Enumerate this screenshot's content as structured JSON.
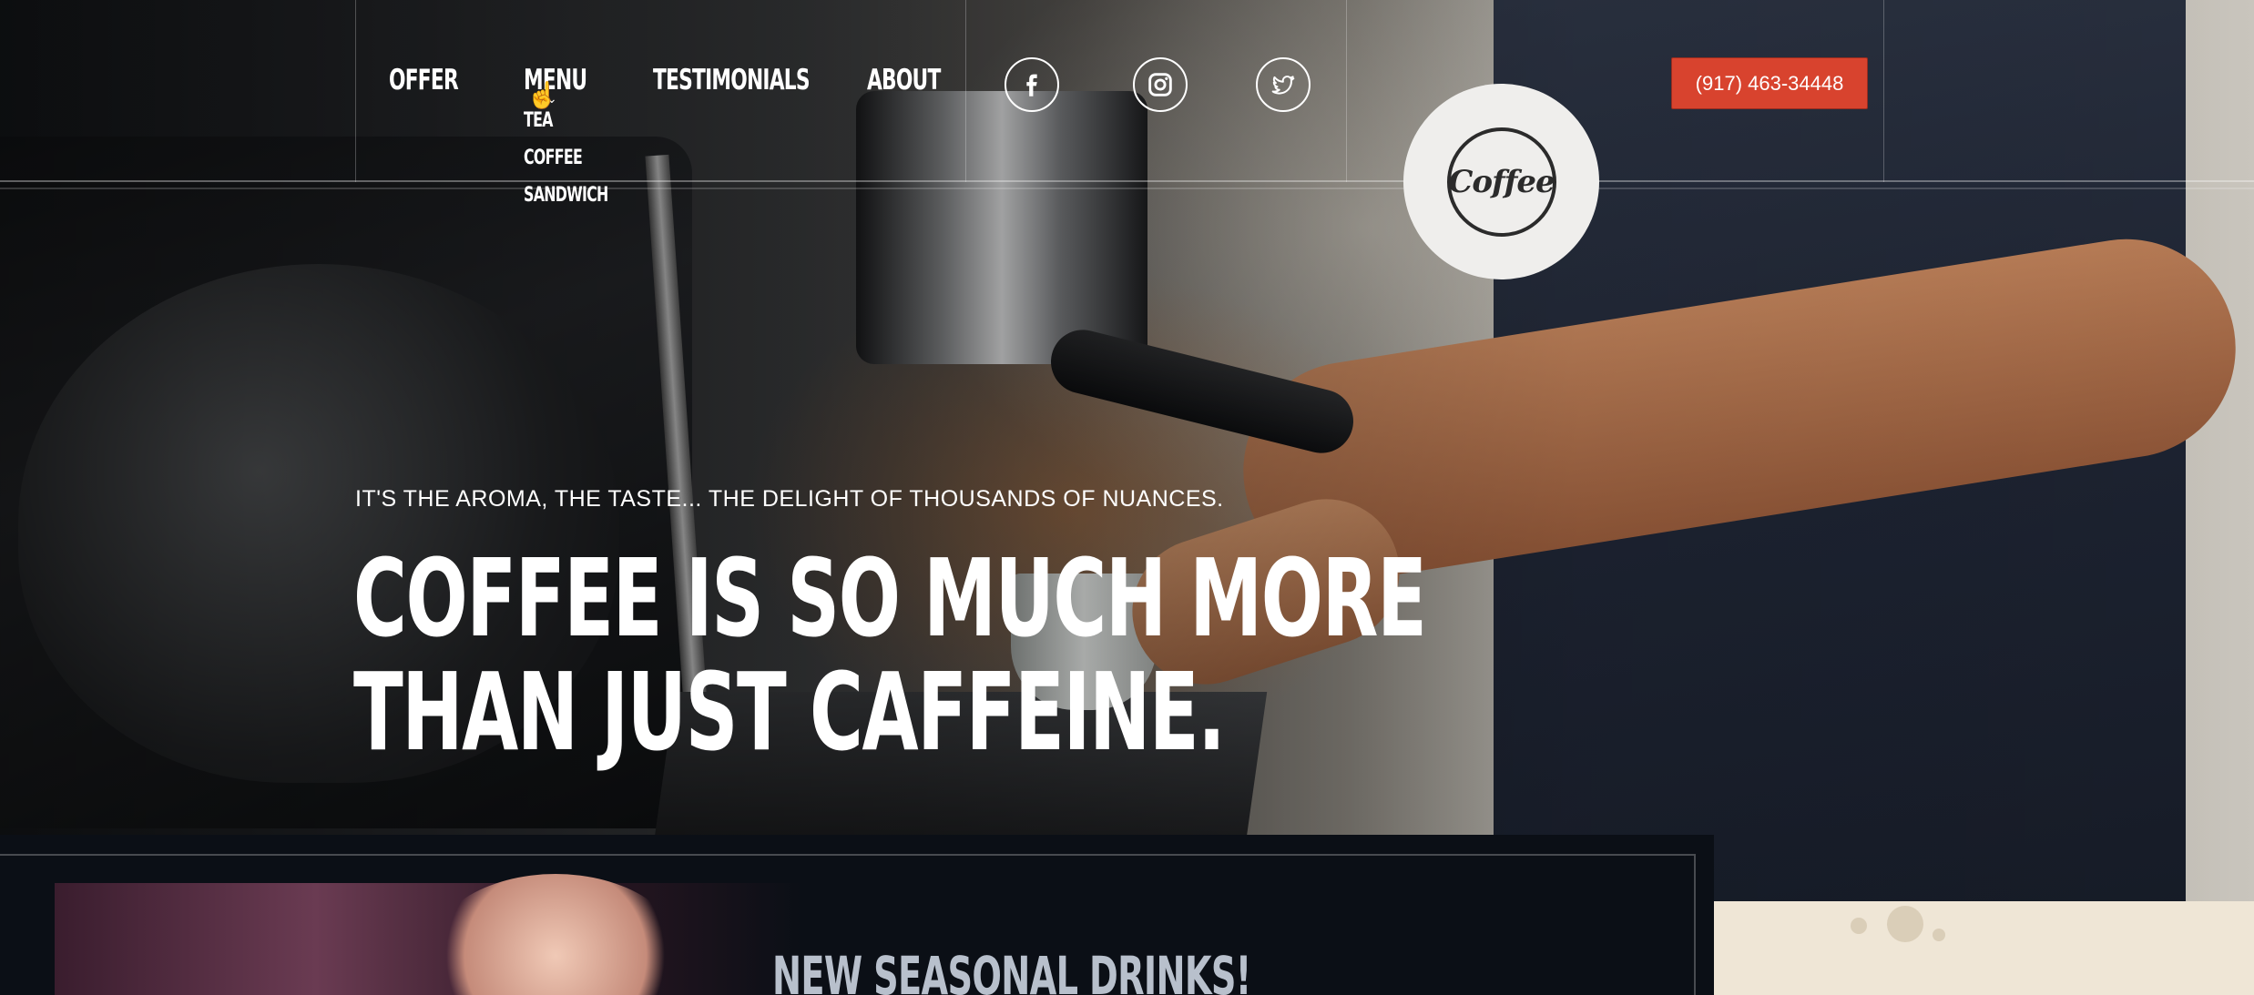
{
  "nav": {
    "items": [
      {
        "label": "OFFER"
      },
      {
        "label": "MENU"
      },
      {
        "label": "TESTIMONIALS"
      },
      {
        "label": "ABOUT"
      }
    ],
    "menu_dropdown": [
      {
        "label": "TEA"
      },
      {
        "label": "COFFEE"
      },
      {
        "label": "SANDWICH"
      }
    ]
  },
  "social": {
    "icons": [
      "facebook-icon",
      "instagram-icon",
      "twitter-icon"
    ]
  },
  "logo": {
    "text": "Coffee"
  },
  "header": {
    "phone": "(917) 463-34448",
    "accent_color": "#d8432e"
  },
  "hero": {
    "tagline": "IT'S THE AROMA, THE TASTE... THE DELIGHT OF THOUSANDS OF NUANCES.",
    "headline_line1": "COFFEE IS SO MUCH MORE",
    "headline_line2": "THAN JUST CAFFEINE."
  },
  "promo": {
    "title": "NEW SEASONAL DRINKS!"
  }
}
